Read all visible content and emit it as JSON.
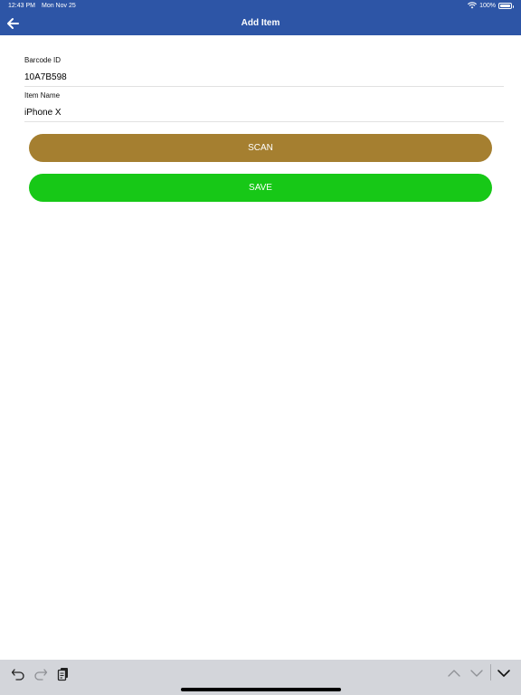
{
  "status_bar": {
    "time": "12:43 PM",
    "date": "Mon Nov 25",
    "battery": "100%"
  },
  "nav": {
    "title": "Add Item"
  },
  "form": {
    "barcode": {
      "label": "Barcode ID",
      "value": "10A7B598"
    },
    "item_name": {
      "label": "Item Name",
      "value": "iPhone X"
    }
  },
  "buttons": {
    "scan": "SCAN",
    "save": "SAVE"
  },
  "colors": {
    "nav_bar": "#2d55a6",
    "scan_button": "#a57f30",
    "save_button": "#17c817",
    "keyboard_bar": "#d3d5da"
  },
  "icons": [
    "back-arrow-icon",
    "wifi-icon",
    "battery-icon",
    "undo-icon",
    "redo-icon",
    "paste-icon",
    "chevron-up-icon",
    "chevron-down-icon",
    "dismiss-keyboard-icon"
  ]
}
